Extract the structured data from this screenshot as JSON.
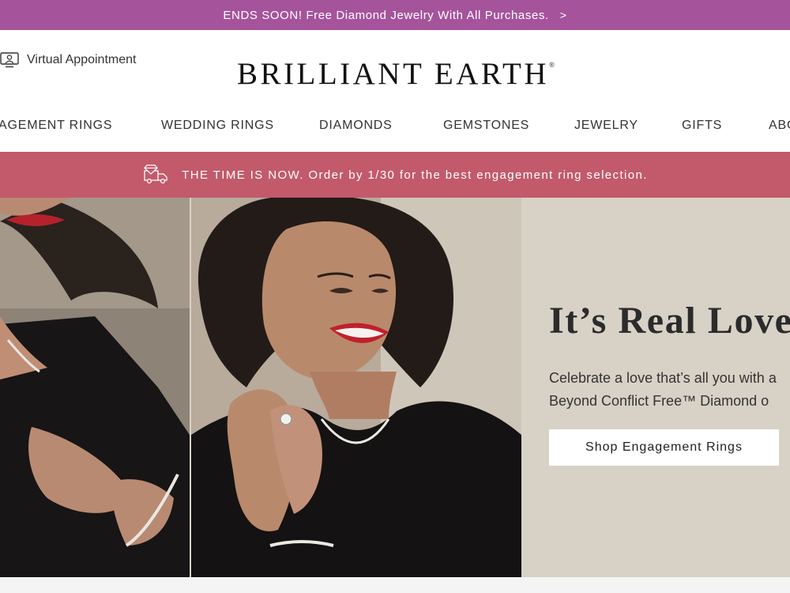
{
  "promo_bar": {
    "text": "ENDS SOON! Free Diamond Jewelry With All Purchases.",
    "chevron": ">"
  },
  "header": {
    "virtual_appointment": "Virtual Appointment",
    "logo": "BRILLIANT EARTH",
    "logo_mark": "®"
  },
  "nav": {
    "items": [
      {
        "label": "AGEMENT RINGS"
      },
      {
        "label": "WEDDING RINGS"
      },
      {
        "label": "DIAMONDS"
      },
      {
        "label": "GEMSTONES"
      },
      {
        "label": "JEWELRY"
      },
      {
        "label": "GIFTS"
      },
      {
        "label": "ABO"
      }
    ]
  },
  "shipping_bar": {
    "icon": "diamond-truck-icon",
    "text": "THE TIME IS NOW. Order by 1/30 for the best engagement ring selection."
  },
  "hero": {
    "title": "It’s Real Love",
    "subtitle_line1": "Celebrate a love that’s all you with a",
    "subtitle_line2": "Beyond Conflict Free™ Diamond o",
    "cta": "Shop Engagement Rings"
  },
  "colors": {
    "promo": "#a5549b",
    "shipping": "#c25a6c",
    "hero_bg": "#d8d1c6"
  }
}
